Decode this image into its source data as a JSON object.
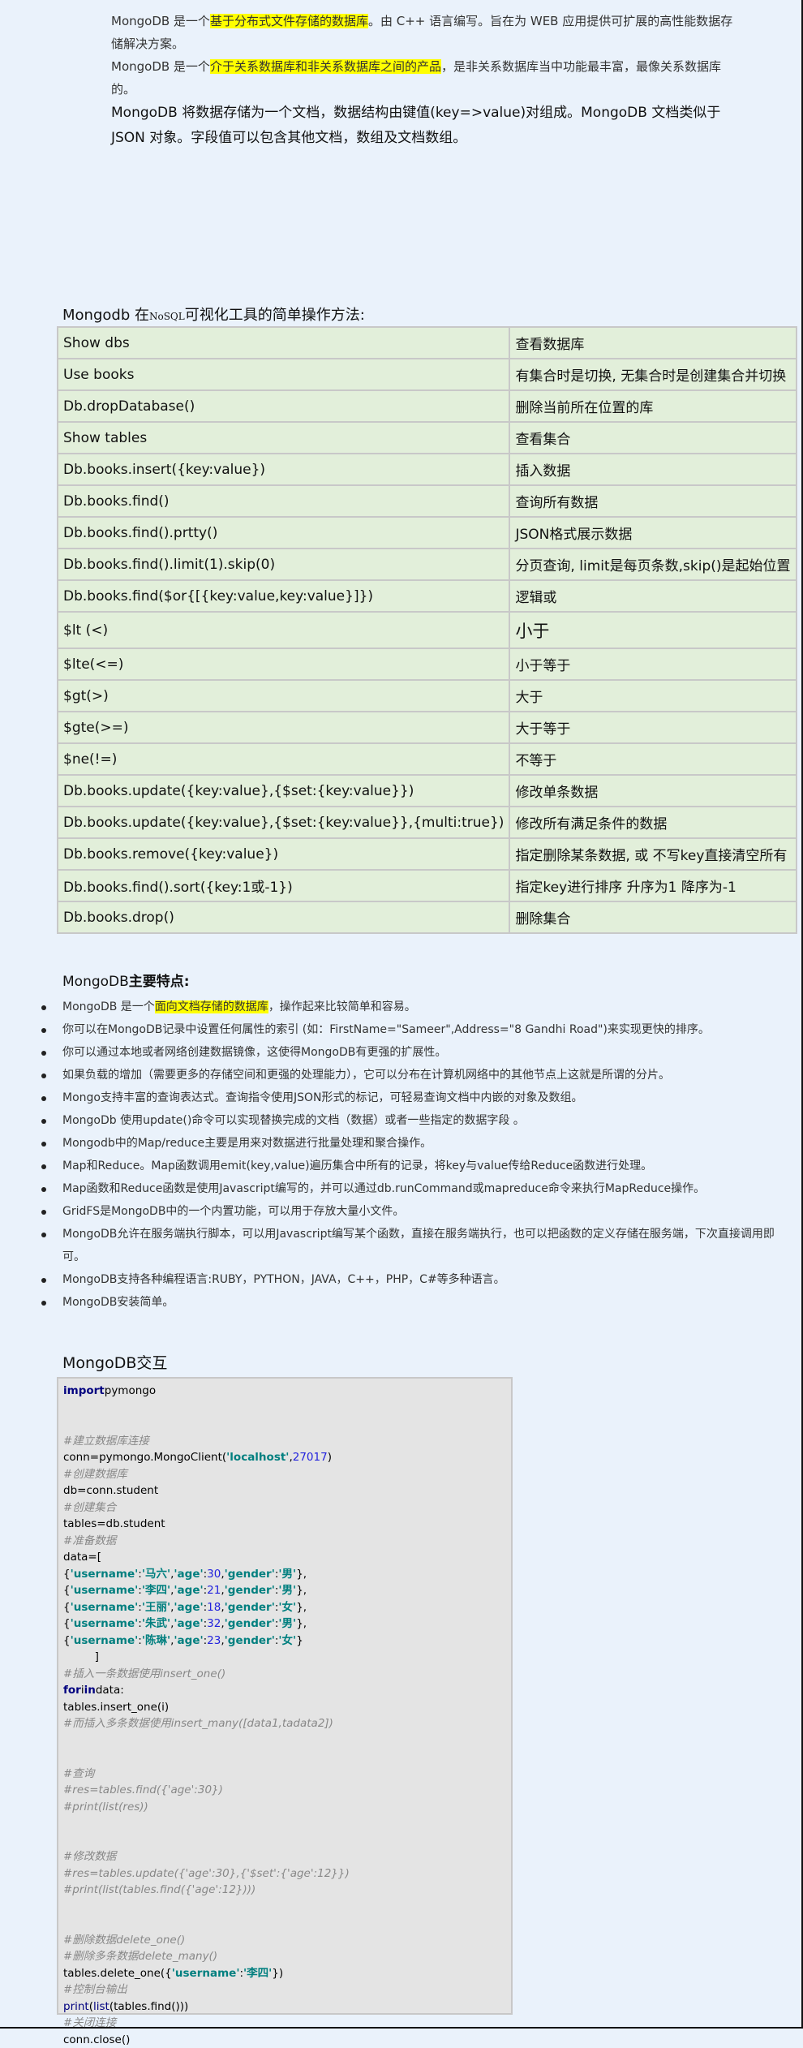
{
  "intro": {
    "p1": {
      "prefix": "MongoDB 是一个",
      "highlight": "基于分布式文件存储的数据库",
      "suffix": "。由 C++ 语言编写。旨在为 WEB 应用提供可扩展的高性能数据存储解决方案。"
    },
    "p2": {
      "prefix": "MongoDB 是一个",
      "highlight": "介于关系数据库和非关系数据库之间的产品",
      "suffix": "，是非关系数据库当中功能最丰富，最像关系数据库的。"
    },
    "p3": "MongoDB 将数据存储为一个文档，数据结构由键值(key=>value)对组成。MongoDB 文档类似于 JSON 对象。字段值可以包含其他文档，数组及文档数组。"
  },
  "commands": {
    "title_prefix": "Mongodb 在",
    "title_small": "NoSQL",
    "title_suffix": "可视化工具的简单操作方法:",
    "rows": [
      {
        "cmd": "Show dbs",
        "desc": "查看数据库"
      },
      {
        "cmd": "Use books",
        "desc": "有集合时是切换, 无集合时是创建集合并切换"
      },
      {
        "cmd": "Db.dropDatabase()",
        "desc": "删除当前所在位置的库"
      },
      {
        "cmd": "Show tables",
        "desc": "查看集合"
      },
      {
        "cmd": "Db.books.insert({key:value})",
        "desc": "插入数据"
      },
      {
        "cmd": "Db.books.find()",
        "desc": "查询所有数据"
      },
      {
        "cmd": "Db.books.find().prtty()",
        "desc": "JSON格式展示数据"
      },
      {
        "cmd": "Db.books.find().limit(1).skip(0)",
        "desc": "分页查询, limit是每页条数,skip()是起始位置"
      },
      {
        "cmd": "Db.books.find($or{[{key:value,key:value}]})",
        "desc": "逻辑或"
      },
      {
        "cmd": "$lt (<)",
        "desc": "小于"
      },
      {
        "cmd": "$lte(<=)",
        "desc": "小于等于"
      },
      {
        "cmd": "$gt(>)",
        "desc": "大于"
      },
      {
        "cmd": "$gte(>=)",
        "desc": "大于等于"
      },
      {
        "cmd": "$ne(!=)",
        "desc": "不等于"
      },
      {
        "cmd": "Db.books.update({key:value},{$set:{key:value}})",
        "desc": "修改单条数据"
      },
      {
        "cmd": "Db.books.update({key:value},{$set:{key:value}},{multi:true})",
        "desc": "修改所有满足条件的数据"
      },
      {
        "cmd": "Db.books.remove({key:value})",
        "desc": "指定删除某条数据, 或 不写key直接清空所有"
      },
      {
        "cmd": "Db.books.find().sort({key:1或-1})",
        "desc": "指定key进行排序 升序为1 降序为-1"
      },
      {
        "cmd": "Db.books.drop()",
        "desc": "删除集合"
      }
    ]
  },
  "features": {
    "title_prefix": "MongoDB",
    "title_bold": "主要特点:",
    "first": {
      "prefix": "MongoDB 是一个",
      "highlight": "面向文档存储的数据库",
      "suffix": "，操作起来比较简单和容易。"
    },
    "items": [
      "你可以在MongoDB记录中设置任何属性的索引 (如：FirstName=\"Sameer\",Address=\"8 Gandhi Road\")来实现更快的排序。",
      "你可以通过本地或者网络创建数据镜像，这使得MongoDB有更强的扩展性。",
      "如果负载的增加（需要更多的存储空间和更强的处理能力），它可以分布在计算机网络中的其他节点上这就是所谓的分片。",
      "Mongo支持丰富的查询表达式。查询指令使用JSON形式的标记，可轻易查询文档中内嵌的对象及数组。",
      "MongoDb 使用update()命令可以实现替换完成的文档（数据）或者一些指定的数据字段 。",
      "Mongodb中的Map/reduce主要是用来对数据进行批量处理和聚合操作。",
      "Map和Reduce。Map函数调用emit(key,value)遍历集合中所有的记录，将key与value传给Reduce函数进行处理。",
      "Map函数和Reduce函数是使用Javascript编写的，并可以通过db.runCommand或mapreduce命令来执行MapReduce操作。",
      "GridFS是MongoDB中的一个内置功能，可以用于存放大量小文件。",
      "MongoDB允许在服务端执行脚本，可以用Javascript编写某个函数，直接在服务端执行，也可以把函数的定义存储在服务端，下次直接调用即可。",
      "MongoDB支持各种编程语言:RUBY，PYTHON，JAVA，C++，PHP，C#等多种语言。",
      "MongoDB安装简单。"
    ]
  },
  "code": {
    "title": "MongoDB交互",
    "lines": [
      [
        {
          "t": "import",
          "c": "kw"
        },
        {
          "t": "pymongo"
        }
      ],
      [],
      [],
      [
        {
          "t": "#建立数据库连接",
          "c": "cm"
        }
      ],
      [
        {
          "t": "conn=pymongo.MongoClient("
        },
        {
          "t": "'localhost'",
          "c": "str"
        },
        {
          "t": ","
        },
        {
          "t": "27017",
          "c": "num"
        },
        {
          "t": ")"
        }
      ],
      [
        {
          "t": "#创建数据库",
          "c": "cm"
        }
      ],
      [
        {
          "t": "db=conn.student"
        }
      ],
      [
        {
          "t": "#创建集合",
          "c": "cm"
        }
      ],
      [
        {
          "t": "tables=db.student"
        }
      ],
      [
        {
          "t": "#准备数据",
          "c": "cm"
        }
      ],
      [
        {
          "t": "data=["
        }
      ],
      [
        {
          "t": "{"
        },
        {
          "t": "'username'",
          "c": "str"
        },
        {
          "t": ":"
        },
        {
          "t": "'马六'",
          "c": "str"
        },
        {
          "t": ","
        },
        {
          "t": "'age'",
          "c": "str"
        },
        {
          "t": ":"
        },
        {
          "t": "30",
          "c": "num"
        },
        {
          "t": ","
        },
        {
          "t": "'gender'",
          "c": "str"
        },
        {
          "t": ":"
        },
        {
          "t": "'男'",
          "c": "str"
        },
        {
          "t": "},"
        }
      ],
      [
        {
          "t": "{"
        },
        {
          "t": "'username'",
          "c": "str"
        },
        {
          "t": ":"
        },
        {
          "t": "'李四'",
          "c": "str"
        },
        {
          "t": ","
        },
        {
          "t": "'age'",
          "c": "str"
        },
        {
          "t": ":"
        },
        {
          "t": "21",
          "c": "num"
        },
        {
          "t": ","
        },
        {
          "t": "'gender'",
          "c": "str"
        },
        {
          "t": ":"
        },
        {
          "t": "'男'",
          "c": "str"
        },
        {
          "t": "},"
        }
      ],
      [
        {
          "t": "{"
        },
        {
          "t": "'username'",
          "c": "str"
        },
        {
          "t": ":"
        },
        {
          "t": "'王丽'",
          "c": "str"
        },
        {
          "t": ","
        },
        {
          "t": "'age'",
          "c": "str"
        },
        {
          "t": ":"
        },
        {
          "t": "18",
          "c": "num"
        },
        {
          "t": ","
        },
        {
          "t": "'gender'",
          "c": "str"
        },
        {
          "t": ":"
        },
        {
          "t": "'女'",
          "c": "str"
        },
        {
          "t": "},"
        }
      ],
      [
        {
          "t": "{"
        },
        {
          "t": "'username'",
          "c": "str"
        },
        {
          "t": ":"
        },
        {
          "t": "'朱武'",
          "c": "str"
        },
        {
          "t": ","
        },
        {
          "t": "'age'",
          "c": "str"
        },
        {
          "t": ":"
        },
        {
          "t": "32",
          "c": "num"
        },
        {
          "t": ","
        },
        {
          "t": "'gender'",
          "c": "str"
        },
        {
          "t": ":"
        },
        {
          "t": "'男'",
          "c": "str"
        },
        {
          "t": "},"
        }
      ],
      [
        {
          "t": "{"
        },
        {
          "t": "'username'",
          "c": "str"
        },
        {
          "t": ":"
        },
        {
          "t": "'陈琳'",
          "c": "str"
        },
        {
          "t": ","
        },
        {
          "t": "'age'",
          "c": "str"
        },
        {
          "t": ":"
        },
        {
          "t": "23",
          "c": "num"
        },
        {
          "t": ","
        },
        {
          "t": "'gender'",
          "c": "str"
        },
        {
          "t": ":"
        },
        {
          "t": "'女'",
          "c": "str"
        },
        {
          "t": "}"
        }
      ],
      [
        {
          "t": "         ]"
        }
      ],
      [
        {
          "t": "#插入一条数据使用insert_one()",
          "c": "cm"
        }
      ],
      [
        {
          "t": "for",
          "c": "kw"
        },
        {
          "t": "i"
        },
        {
          "t": "in",
          "c": "kw"
        },
        {
          "t": "data:"
        }
      ],
      [
        {
          "t": "tables.insert_one(i)"
        }
      ],
      [
        {
          "t": "#而插入多条数据使用insert_many([data1,tadata2])",
          "c": "cm"
        }
      ],
      [],
      [],
      [
        {
          "t": "#查询",
          "c": "cm"
        }
      ],
      [
        {
          "t": "#res=tables.find({'age':30})",
          "c": "cm"
        }
      ],
      [
        {
          "t": "#print(list(res))",
          "c": "cm"
        }
      ],
      [],
      [],
      [
        {
          "t": "#修改数据",
          "c": "cm"
        }
      ],
      [
        {
          "t": "#res=tables.update({'age':30},{'$set':{'age':12}})",
          "c": "cm"
        }
      ],
      [
        {
          "t": "#print(list(tables.find({'age':12})))",
          "c": "cm"
        }
      ],
      [],
      [],
      [
        {
          "t": "#删除数据delete_one()",
          "c": "cm"
        }
      ],
      [
        {
          "t": "#删除多条数据delete_many()",
          "c": "cm"
        }
      ],
      [
        {
          "t": "tables.delete_one({"
        },
        {
          "t": "'username'",
          "c": "str"
        },
        {
          "t": ":"
        },
        {
          "t": "'李四'",
          "c": "str"
        },
        {
          "t": "})"
        }
      ],
      [
        {
          "t": "#控制台输出",
          "c": "cm"
        }
      ],
      [
        {
          "t": "print",
          "c": "fn"
        },
        {
          "t": "("
        },
        {
          "t": "list",
          "c": "fn"
        },
        {
          "t": "(tables.find()))"
        }
      ],
      [
        {
          "t": "#关闭连接",
          "c": "cm"
        }
      ],
      [
        {
          "t": "conn.close()"
        }
      ]
    ]
  }
}
